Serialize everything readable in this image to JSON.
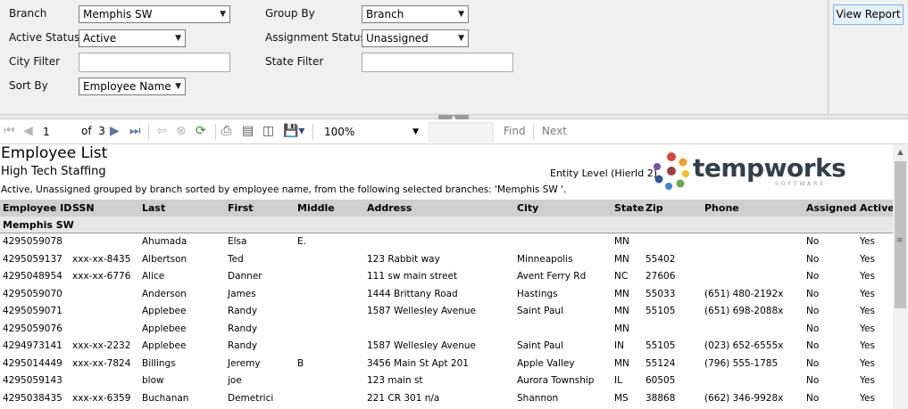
{
  "params": {
    "branch": {
      "label": "Branch",
      "value": "Memphis SW"
    },
    "active_status": {
      "label": "Active Status",
      "value": "Active"
    },
    "city_filter": {
      "label": "City Filter",
      "value": ""
    },
    "sort_by": {
      "label": "Sort By",
      "value": "Employee Name"
    },
    "group_by": {
      "label": "Group By",
      "value": "Branch"
    },
    "assignment_status": {
      "label": "Assignment Status",
      "value": "Unassigned"
    },
    "state_filter": {
      "label": "State Filter",
      "value": ""
    },
    "view_report": "View Report"
  },
  "toolbar": {
    "page": "1",
    "of": "of",
    "total_pages": "3",
    "zoom": "100%",
    "find_value": "",
    "find": "Find",
    "next": "Next"
  },
  "report": {
    "title": "Employee List",
    "company": "High Tech Staffing",
    "entity_level": "Entity Level (HierId 2)",
    "description": "Active, Unassigned grouped by branch sorted by employee name, from the following selected branches: 'Memphis SW '.",
    "logo": {
      "text": "tempworks",
      "subtext": "SOFTWARE"
    },
    "columns": [
      "Employee ID",
      "SSN",
      "Last",
      "First",
      "Middle",
      "Address",
      "City",
      "State",
      "Zip",
      "Phone",
      "Assigned",
      "Active"
    ],
    "group": "Memphis SW",
    "rows": [
      {
        "id": "4295059078",
        "ssn": "",
        "last": "Ahumada",
        "first": "Elsa",
        "middle": "E.",
        "address": "",
        "city": "",
        "state": "MN",
        "zip": "",
        "phone": "",
        "assigned": "No",
        "active": "Yes"
      },
      {
        "id": "4295059137",
        "ssn": "xxx-xx-8435",
        "last": "Albertson",
        "first": "Ted",
        "middle": "",
        "address": "123 Rabbit way",
        "city": "Minneapolis",
        "state": "MN",
        "zip": "55402",
        "phone": "",
        "assigned": "No",
        "active": "Yes"
      },
      {
        "id": "4295048954",
        "ssn": "xxx-xx-6776",
        "last": "Alice",
        "first": "Danner",
        "middle": "",
        "address": "111 sw main street",
        "city": "Avent Ferry Rd",
        "state": "NC",
        "zip": "27606",
        "phone": "",
        "assigned": "No",
        "active": "Yes"
      },
      {
        "id": "4295059070",
        "ssn": "",
        "last": "Anderson",
        "first": "James",
        "middle": "",
        "address": "1444 Brittany Road",
        "city": "Hastings",
        "state": "MN",
        "zip": "55033",
        "phone": "(651) 480-2192x",
        "assigned": "No",
        "active": "Yes"
      },
      {
        "id": "4295059071",
        "ssn": "",
        "last": "Applebee",
        "first": "Randy",
        "middle": "",
        "address": "1587 Wellesley Avenue",
        "city": "Saint Paul",
        "state": "MN",
        "zip": "55105",
        "phone": "(651) 698-2088x",
        "assigned": "No",
        "active": "Yes"
      },
      {
        "id": "4295059076",
        "ssn": "",
        "last": "Applebee",
        "first": "Randy",
        "middle": "",
        "address": "",
        "city": "",
        "state": "MN",
        "zip": "",
        "phone": "",
        "assigned": "No",
        "active": "Yes"
      },
      {
        "id": "4294973141",
        "ssn": "xxx-xx-2232",
        "last": "Applebee",
        "first": "Randy",
        "middle": "",
        "address": "1587 Wellesley Avenue",
        "city": "Saint Paul",
        "state": "IN",
        "zip": "55105",
        "phone": "(023) 652-6555x",
        "assigned": "No",
        "active": "Yes"
      },
      {
        "id": "4295014449",
        "ssn": "xxx-xx-7824",
        "last": "Billings",
        "first": "Jeremy",
        "middle": "B",
        "address": "3456 Main St  Apt 201",
        "city": "Apple Valley",
        "state": "MN",
        "zip": "55124",
        "phone": "(796) 555-1785",
        "assigned": "No",
        "active": "Yes"
      },
      {
        "id": "4295059143",
        "ssn": "",
        "last": "blow",
        "first": "joe",
        "middle": "",
        "address": "123 main st",
        "city": "Aurora Township",
        "state": "IL",
        "zip": "60505",
        "phone": "",
        "assigned": "No",
        "active": "Yes"
      },
      {
        "id": "4295038435",
        "ssn": "xxx-xx-6359",
        "last": "Buchanan",
        "first": "Demetrici",
        "middle": "",
        "address": "221 CR 301  n/a",
        "city": "Shannon",
        "state": "MS",
        "zip": "38868",
        "phone": "(662) 346-9928x",
        "assigned": "No",
        "active": "Yes"
      }
    ]
  }
}
